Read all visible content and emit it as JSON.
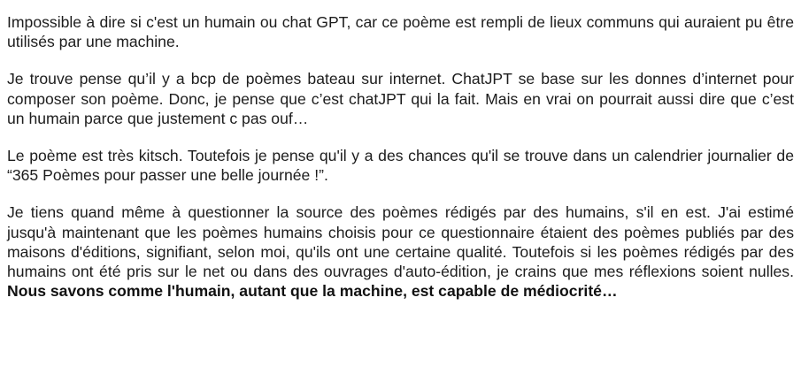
{
  "responses": [
    {
      "text": "Impossible à dire si c'est un humain ou chat GPT, car ce poème est rempli de lieux communs qui auraient pu être utilisés par une machine."
    },
    {
      "text": "Je trouve pense qu’il y a bcp de poèmes bateau sur internet. ChatJPT se base sur les donnes d’internet pour composer son poème. Donc, je pense que c’est chatJPT qui la fait. Mais en vrai on pourrait aussi dire que c’est un humain parce que justement c pas ouf…"
    },
    {
      "text": "Le poème est très kitsch. Toutefois je pense qu'il y a des chances qu'il se trouve dans un calendrier journalier de “365 Poèmes pour passer une belle journée !”."
    },
    {
      "text": "Je tiens quand même à questionner la source des poèmes rédigés par des humains, s'il en est. J'ai estimé jusqu'à maintenant que les poèmes humains choisis pour ce questionnaire étaient des poèmes publiés par des maisons d'éditions, signifiant, selon moi, qu'ils ont une certaine qualité. Toutefois si les poèmes rédigés par des humains ont été pris sur le net ou dans des ouvrages d'auto-édition, je crains que mes réflexions soient nulles. ",
      "bold_text": "Nous savons comme l'humain, autant que la machine, est capable de médiocrité…"
    }
  ]
}
